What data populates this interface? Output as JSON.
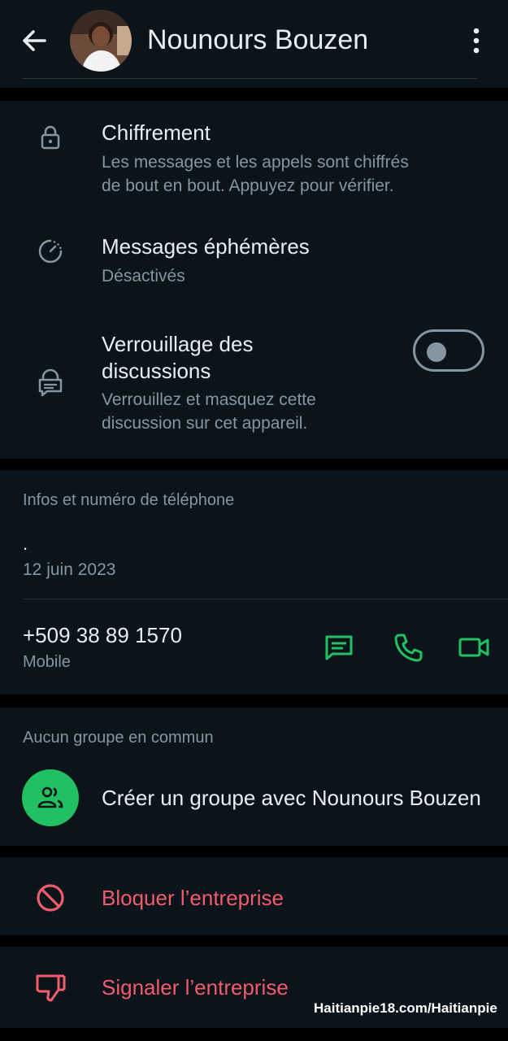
{
  "header": {
    "title": "Nounours Bouzen"
  },
  "privacy": {
    "encryption": {
      "title": "Chiffrement",
      "subtitle_line1": "Les messages et les appels sont chiffrés",
      "subtitle_line2": "de bout en bout. Appuyez pour vérifier."
    },
    "disappearing": {
      "title": "Messages éphémères",
      "subtitle": "Désactivés"
    },
    "chat_lock": {
      "title_line1": "Verrouillage des",
      "title_line2": "discussions",
      "subtitle_line1": "Verrouillez et masquez cette",
      "subtitle_line2": "discussion sur cet appareil.",
      "enabled": false
    }
  },
  "info": {
    "header": "Infos et numéro de téléphone",
    "about": ".",
    "about_date": "12 juin 2023",
    "phone": "+509 38 89 1570",
    "phone_type": "Mobile"
  },
  "groups": {
    "header": "Aucun groupe en commun",
    "create_label": "Créer un groupe avec Nounours Bouzen"
  },
  "actions": {
    "block": "Bloquer l’entreprise",
    "report": "Signaler l’entreprise"
  },
  "watermark": "Haitianpie18.com/Haitianpie",
  "colors": {
    "background": "#0b141a",
    "accent_green": "#21c063",
    "danger_red": "#f15c6d",
    "secondary_text": "#8696a0"
  },
  "icons": [
    "back-arrow-icon",
    "more-vert-icon",
    "lock-icon",
    "timer-icon",
    "chat-lock-icon",
    "message-icon",
    "phone-icon",
    "video-icon",
    "group-icon",
    "block-icon",
    "thumbs-down-icon"
  ]
}
